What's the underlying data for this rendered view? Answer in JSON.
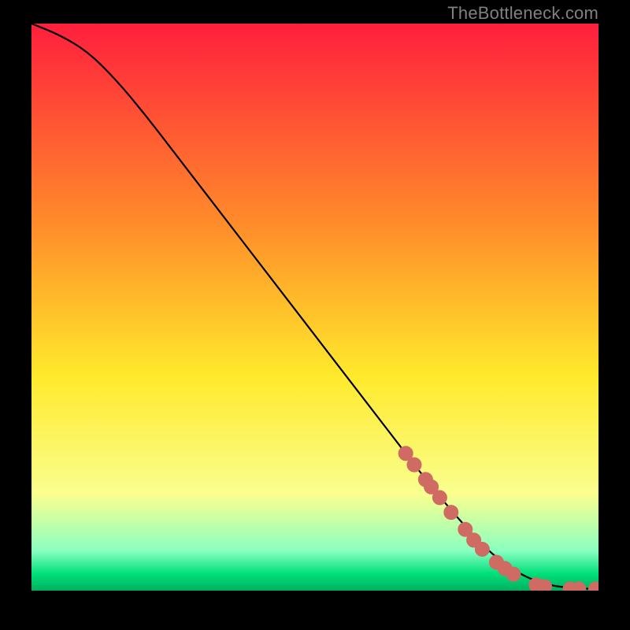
{
  "watermark": "TheBottleneck.com",
  "colors": {
    "background": "#000000",
    "curve": "#000000",
    "marker_fill": "#cf6b63",
    "marker_stroke": "#cf6b63",
    "gradient_top": "#ff1f3d",
    "gradient_mid_upper": "#ff8b2a",
    "gradient_mid": "#ffe92b",
    "gradient_mid_lower": "#faff8f",
    "gradient_green_light": "#8affc1",
    "gradient_green": "#00e07a",
    "gradient_green_dark": "#00b060"
  },
  "chart_data": {
    "type": "line",
    "title": "",
    "xlabel": "",
    "ylabel": "",
    "xlim": [
      0,
      100
    ],
    "ylim": [
      0,
      100
    ],
    "grid": false,
    "series": [
      {
        "name": "curve",
        "x": [
          0,
          5,
          10,
          15,
          20,
          25,
          30,
          35,
          40,
          45,
          50,
          55,
          60,
          65,
          70,
          75,
          80,
          85,
          90,
          95,
          100
        ],
        "y": [
          100,
          98,
          95,
          90,
          84,
          77.5,
          71,
          64.5,
          58,
          51.5,
          45,
          38.5,
          32,
          25.5,
          19,
          13,
          7.5,
          3.5,
          1.2,
          0.4,
          0.3
        ]
      }
    ],
    "markers": [
      {
        "x": 66,
        "y": 24.2
      },
      {
        "x": 67.5,
        "y": 22.2
      },
      {
        "x": 69.5,
        "y": 19.6
      },
      {
        "x": 70.5,
        "y": 18.3
      },
      {
        "x": 72,
        "y": 16.4
      },
      {
        "x": 74,
        "y": 13.8
      },
      {
        "x": 76.5,
        "y": 10.8
      },
      {
        "x": 78,
        "y": 8.9
      },
      {
        "x": 79.5,
        "y": 7.3
      },
      {
        "x": 82,
        "y": 5.0
      },
      {
        "x": 83.5,
        "y": 3.9
      },
      {
        "x": 85,
        "y": 2.9
      },
      {
        "x": 89,
        "y": 1.0
      },
      {
        "x": 90.5,
        "y": 0.7
      },
      {
        "x": 95,
        "y": 0.3
      },
      {
        "x": 96.5,
        "y": 0.3
      },
      {
        "x": 99.5,
        "y": 0.3
      }
    ],
    "marker_radius_px": 9
  }
}
